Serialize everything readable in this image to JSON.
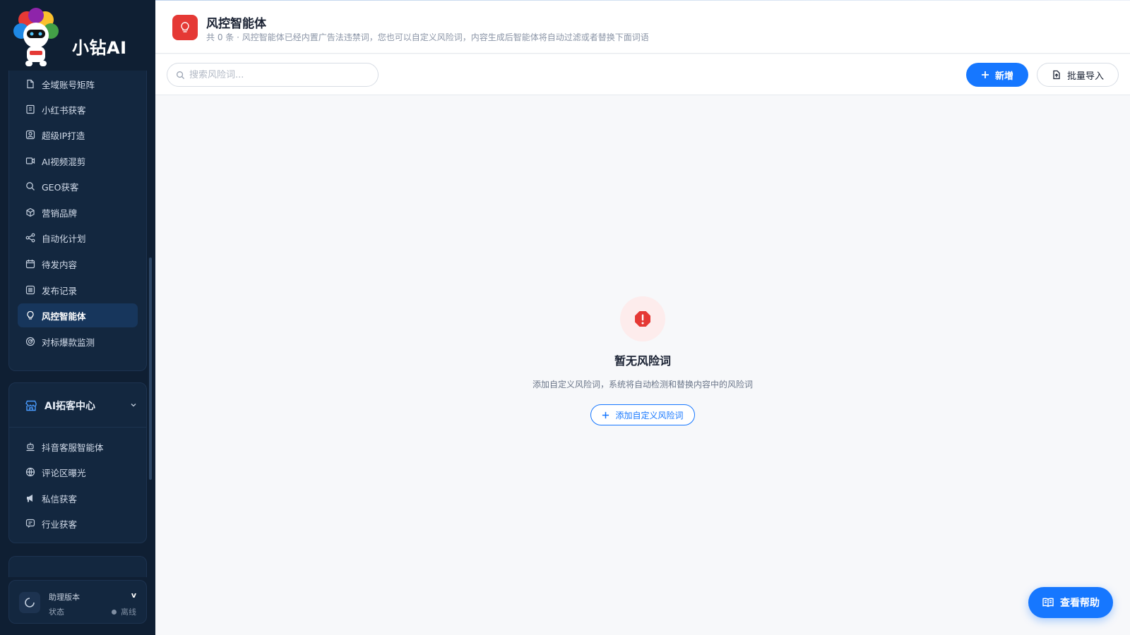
{
  "app": {
    "name": "小钻AI"
  },
  "sidebar": {
    "items": [
      {
        "label": "全域账号矩阵",
        "icon": "file-icon"
      },
      {
        "label": "小红书获客",
        "icon": "book-icon"
      },
      {
        "label": "超级IP打造",
        "icon": "user-badge-icon"
      },
      {
        "label": "AI视频混剪",
        "icon": "video-icon"
      },
      {
        "label": "GEO获客",
        "icon": "search-icon"
      },
      {
        "label": "营销品牌",
        "icon": "cube-icon"
      },
      {
        "label": "自动化计划",
        "icon": "share-icon"
      },
      {
        "label": "待发内容",
        "icon": "calendar-icon"
      },
      {
        "label": "发布记录",
        "icon": "list-icon"
      },
      {
        "label": "风控智能体",
        "icon": "lightbulb-icon",
        "active": true
      },
      {
        "label": "对标爆款监测",
        "icon": "radar-icon"
      }
    ],
    "group2": {
      "title": "AI拓客中心",
      "icon": "store-icon",
      "items": [
        {
          "label": "抖音客服智能体",
          "icon": "robot-icon"
        },
        {
          "label": "评论区曝光",
          "icon": "globe-icon"
        },
        {
          "label": "私信获客",
          "icon": "megaphone-icon"
        },
        {
          "label": "行业获客",
          "icon": "message-icon"
        }
      ]
    },
    "status": {
      "version_label": "助理版本",
      "version_value": "v",
      "state_label": "状态",
      "state_value": "离线"
    }
  },
  "header": {
    "title": "风控智能体",
    "subtitle": "共 0 条 · 风控智能体已经内置广告法违禁词，您也可以自定义风险词，内容生成后智能体将自动过滤或者替换下面词语"
  },
  "toolbar": {
    "search_placeholder": "搜索风险词...",
    "add_label": "新增",
    "import_label": "批量导入"
  },
  "empty_state": {
    "title": "暂无风险词",
    "description": "添加自定义风险词，系统将自动检测和替换内容中的风险词",
    "button_label": "添加自定义风险词"
  },
  "help": {
    "label": "查看帮助"
  },
  "colors": {
    "primary": "#1677ff",
    "danger": "#e53935",
    "sidebar_bg": "#0f1f33"
  }
}
